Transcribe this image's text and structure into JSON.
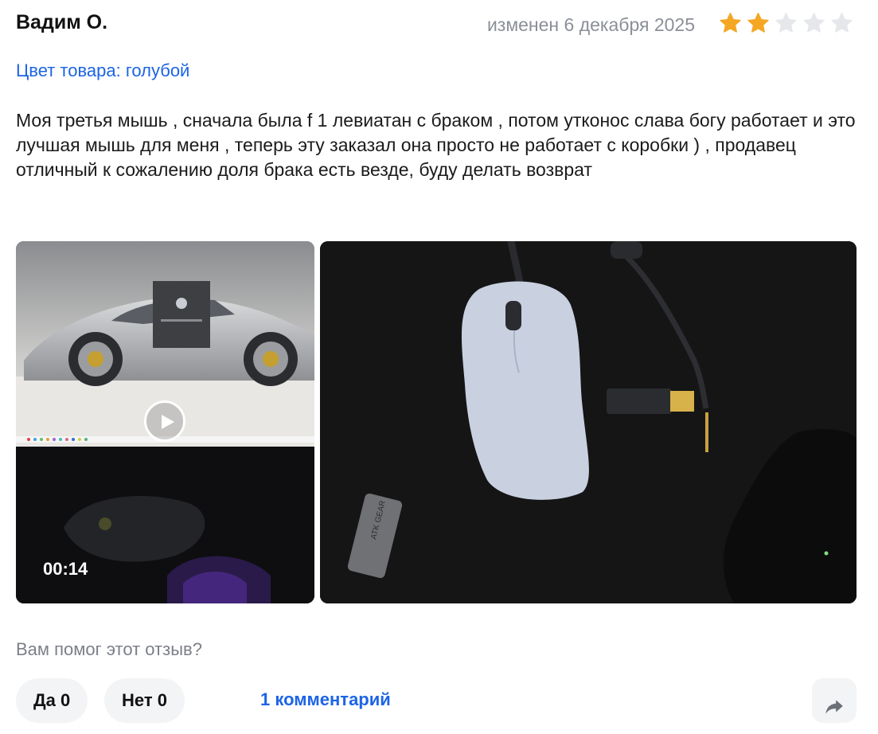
{
  "review": {
    "author": "Вадим О.",
    "date": "изменен 6 декабря 2025",
    "rating": 2,
    "max_rating": 5,
    "color_line": "Цвет товара: голубой",
    "text": "Моя третья мышь , сначала была f 1 левиатан с браком , потом утконос слава богу работает и это лучшая мышь для меня , теперь эту заказал она просто не работает с коробки ) , продавец отличный к сожалению доля брака есть везде, буду делать возврат",
    "video_duration": "00:14",
    "photo_label": "ATK GEAR"
  },
  "feedback": {
    "question": "Вам помог этот отзыв?",
    "yes_label": "Да 0",
    "no_label": "Нет 0",
    "comments_label": "1 комментарий"
  },
  "colors": {
    "accent": "#1c64e6",
    "star_filled": "#f5a623",
    "star_empty": "#e5e7ea",
    "muted_text": "#8b8f97"
  },
  "icons": {
    "star": "star-icon",
    "play": "play-icon",
    "share": "share-icon"
  }
}
